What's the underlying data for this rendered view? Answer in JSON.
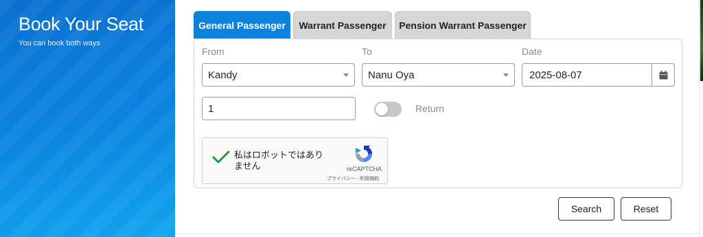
{
  "sidebar": {
    "title": "Book Your Seat",
    "subtitle": "You can book both ways"
  },
  "tabs": [
    {
      "label": "General Passenger",
      "active": true
    },
    {
      "label": "Warrant Passenger",
      "active": false
    },
    {
      "label": "Pension Warrant Passenger",
      "active": false
    }
  ],
  "form": {
    "from_label": "From",
    "from_value": "Kandy",
    "to_label": "To",
    "to_value": "Nanu Oya",
    "date_label": "Date",
    "date_value": "2025-08-07",
    "passengers_value": "1",
    "return_label": "Return",
    "return_enabled": false
  },
  "recaptcha": {
    "text": "私はロボットではありません",
    "brand": "reCAPTCHA",
    "links": "プライバシー - 利用規約",
    "checked": true
  },
  "buttons": {
    "search": "Search",
    "reset": "Reset"
  },
  "colors": {
    "accent": "#0d82dc",
    "check": "#1e9a3c"
  }
}
